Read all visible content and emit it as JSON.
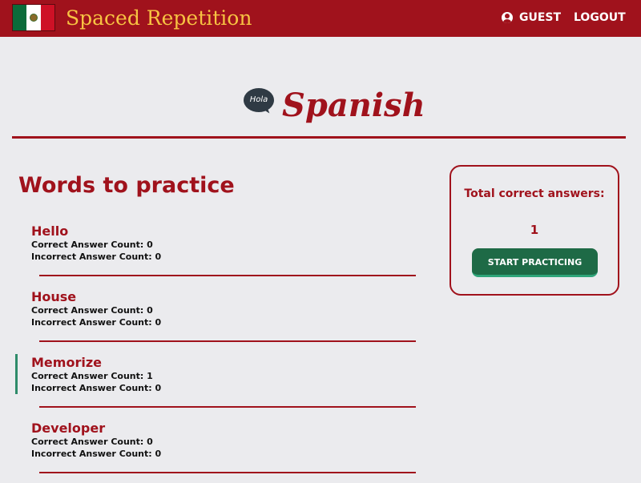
{
  "header": {
    "app_title": "Spaced Repetition",
    "user_label": "GUEST",
    "logout_label": "LOGOUT",
    "brand_color": "#a0121c",
    "title_color": "#f7c342"
  },
  "language": {
    "bubble_text": "Hola",
    "name": "Spanish"
  },
  "words_section": {
    "title": "Words to practice",
    "items": [
      {
        "word": "Hello",
        "correct": "Correct Answer Count: 0",
        "incorrect": "Incorrect Answer Count: 0"
      },
      {
        "word": "House",
        "correct": "Correct Answer Count: 0",
        "incorrect": "Incorrect Answer Count: 0"
      },
      {
        "word": "Memorize",
        "correct": "Correct Answer Count: 1",
        "incorrect": "Incorrect Answer Count: 0"
      },
      {
        "word": "Developer",
        "correct": "Correct Answer Count: 0",
        "incorrect": "Incorrect Answer Count: 0"
      }
    ]
  },
  "score_card": {
    "label": "Total correct answers:",
    "value": "1",
    "button_label": "START PRACTICING",
    "button_color": "#1e6a46"
  }
}
